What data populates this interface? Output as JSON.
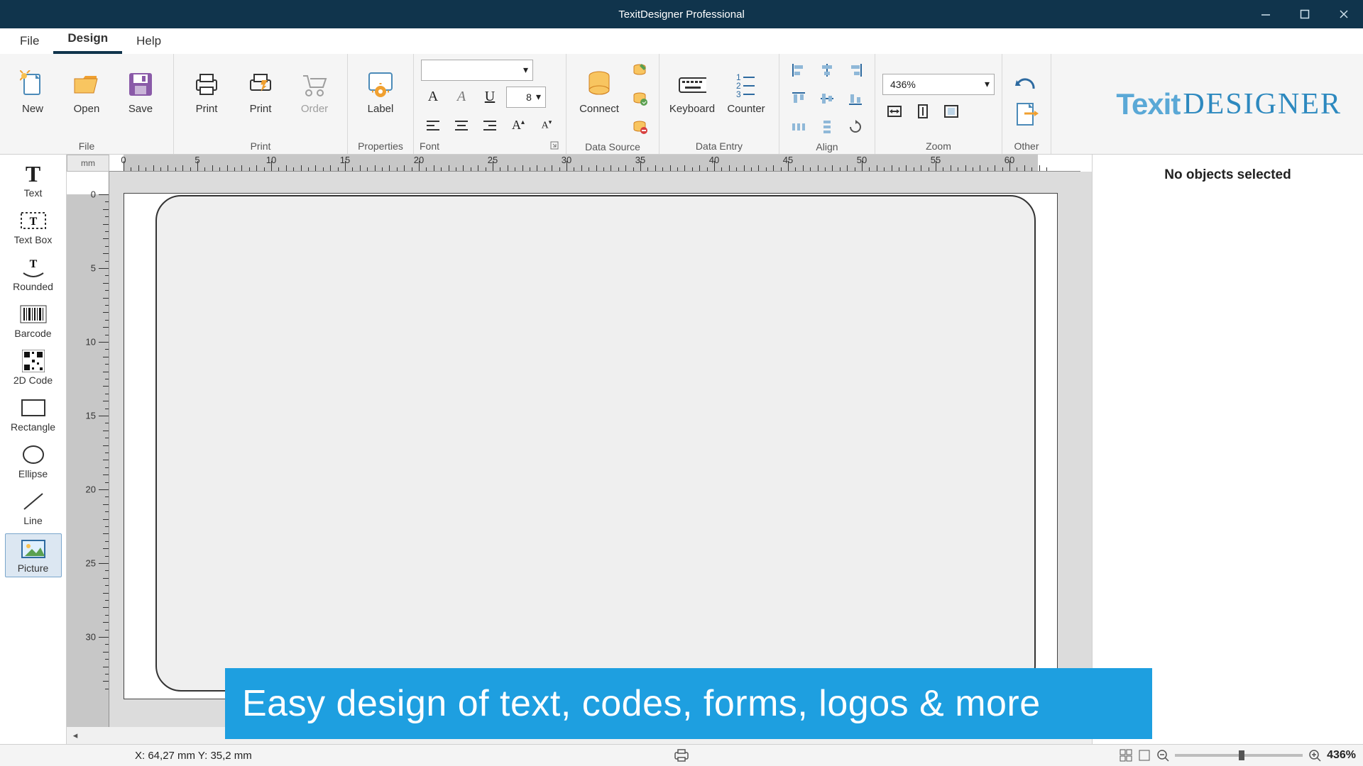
{
  "app": {
    "title": "TexitDesigner Professional"
  },
  "menu": {
    "file": "File",
    "design": "Design",
    "help": "Help"
  },
  "ribbon": {
    "file": {
      "label": "File",
      "new": "New",
      "open": "Open",
      "save": "Save"
    },
    "print": {
      "label": "Print",
      "print": "Print",
      "quick": "Print",
      "order": "Order"
    },
    "props": {
      "label": "Properties",
      "labelbtn": "Label"
    },
    "font": {
      "label": "Font",
      "family": "",
      "size": "8"
    },
    "ds": {
      "label": "Data Source",
      "connect": "Connect"
    },
    "de": {
      "label": "Data Entry",
      "keyboard": "Keyboard",
      "counter": "Counter"
    },
    "align": {
      "label": "Align"
    },
    "zoom": {
      "label": "Zoom",
      "value": "436%"
    },
    "other": {
      "label": "Other"
    }
  },
  "brand": {
    "a": "Texit",
    "b": "DESIGNER"
  },
  "tools": {
    "text": "Text",
    "textbox": "Text Box",
    "rounded": "Rounded",
    "barcode": "Barcode",
    "code2d": "2D Code",
    "rect": "Rectangle",
    "ellipse": "Ellipse",
    "line": "Line",
    "picture": "Picture"
  },
  "ruler": {
    "unit": "mm",
    "h_ticks": [
      "0",
      "5",
      "10",
      "15",
      "20",
      "25",
      "30",
      "35",
      "40",
      "45",
      "50",
      "55",
      "60"
    ],
    "v_ticks": [
      "0",
      "5",
      "10",
      "15",
      "20",
      "25",
      "30"
    ]
  },
  "panel": {
    "no_selection": "No objects selected"
  },
  "status": {
    "coords": "X: 64,27 mm Y: 35,2 mm",
    "zoom": "436%"
  },
  "banner": {
    "text": "Easy design of text, codes, forms, logos & more"
  }
}
